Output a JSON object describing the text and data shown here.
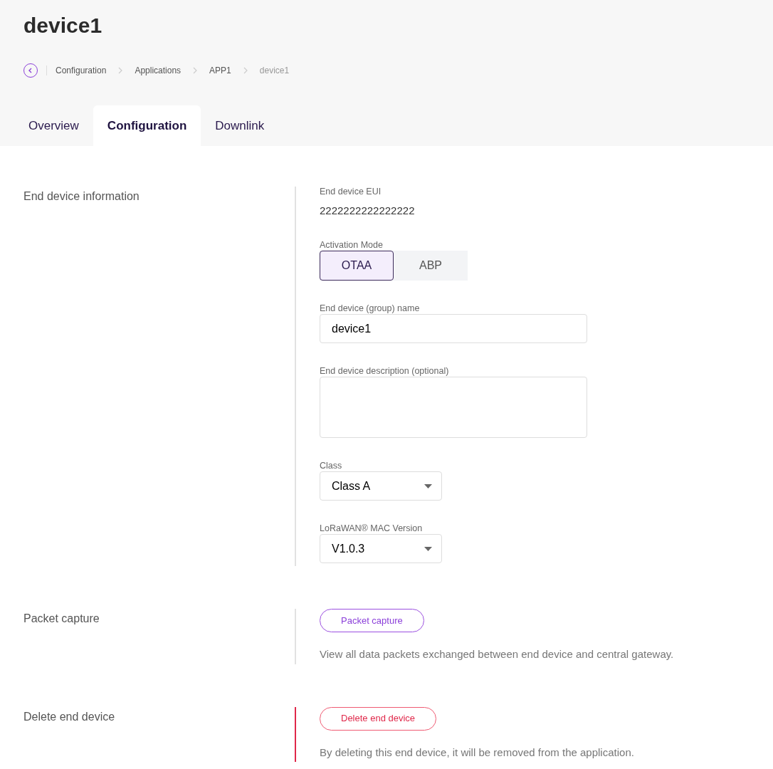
{
  "title": "device1",
  "breadcrumb": [
    {
      "label": "Configuration",
      "current": false
    },
    {
      "label": "Applications",
      "current": false
    },
    {
      "label": "APP1",
      "current": false
    },
    {
      "label": "device1",
      "current": true
    }
  ],
  "tabs": [
    {
      "label": "Overview",
      "selected": false
    },
    {
      "label": "Configuration",
      "selected": true
    },
    {
      "label": "Downlink",
      "selected": false
    }
  ],
  "sections": [
    {
      "kind": "form",
      "title": "End device information",
      "fields": [
        {
          "kind": "text",
          "label": "End device EUI",
          "value": "2222222222222222"
        },
        {
          "kind": "segmented",
          "label": "Activation Mode",
          "options": [
            {
              "label": "OTAA",
              "selected": true
            },
            {
              "label": "ABP",
              "selected": false
            }
          ]
        },
        {
          "kind": "input",
          "label": "End device (group) name",
          "value": "device1"
        },
        {
          "kind": "textarea",
          "label": "End device description (optional)"
        },
        {
          "kind": "select",
          "label": "Class",
          "value": "Class A"
        },
        {
          "kind": "select",
          "label": "LoRaWAN® MAC Version",
          "value": "V1.0.3"
        }
      ]
    },
    {
      "kind": "action",
      "title": "Packet capture",
      "button": {
        "label": "Packet capture",
        "kind": "primary"
      },
      "description": "View all data packets exchanged between end device and central gateway."
    },
    {
      "kind": "action",
      "title": "Delete end device",
      "button": {
        "label": "Delete end device",
        "kind": "danger"
      },
      "description": "By deleting this end device, it will be removed from the application."
    }
  ]
}
